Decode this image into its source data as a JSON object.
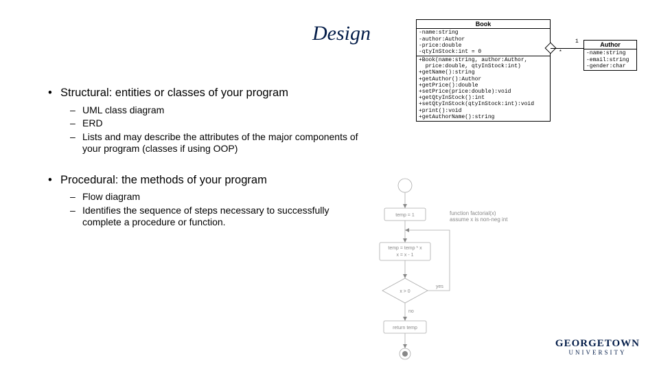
{
  "title": "Design",
  "bullets": {
    "structural": {
      "text": "Structural: entities or classes of your program",
      "subs": [
        "UML class diagram",
        "ERD",
        "Lists and may describe the attributes of the major components of your program (classes if using OOP)"
      ]
    },
    "procedural": {
      "text": "Procedural: the methods of your program",
      "subs": [
        "Flow diagram",
        "Identifies the sequence of steps necessary to successfully complete a procedure or function."
      ]
    }
  },
  "uml": {
    "book": {
      "name": "Book",
      "attrs": "-name:string\n-author:Author\n-price:double\n-qtyInStock:int = 0",
      "ops": "+Book(name:string, author:Author,\n  price:double, qtyInStock:int)\n+getName():string\n+getAuthor():Author\n+getPrice():double\n+setPrice(price:double):void\n+getQtyInStock():int\n+setQtyInStock(qtyInStock:int):void\n+print():void\n+getAuthorName():string"
    },
    "author": {
      "name": "Author",
      "attrs": "-name:string\n-email:string\n-gender:char"
    },
    "mult_star": "*",
    "mult_one": "1"
  },
  "flow": {
    "start": "",
    "init": "temp = 1",
    "note": "function factorial(x)\nassume x is non-neg int",
    "step": "temp = temp * x\nx = x - 1",
    "cond": "x > 0",
    "ret": "return temp",
    "yes": "yes",
    "no": "no"
  },
  "logo": {
    "line1": "GEORGETOWN",
    "line2": "UNIVERSITY"
  }
}
